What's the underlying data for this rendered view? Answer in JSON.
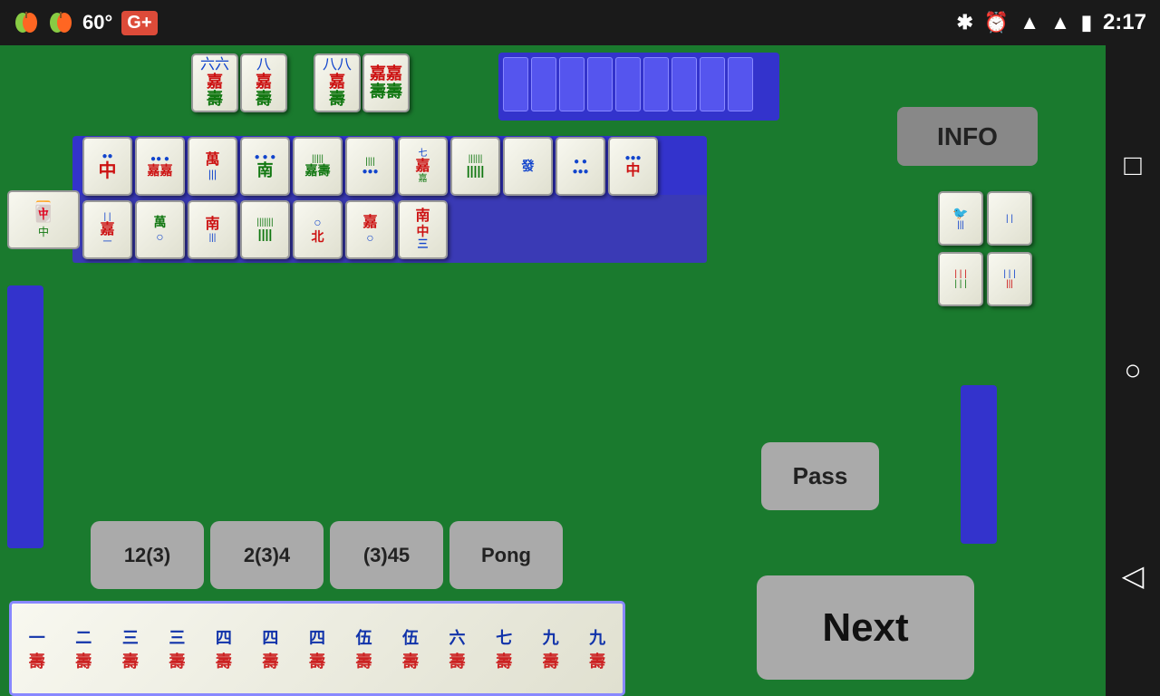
{
  "statusBar": {
    "temp": "60°",
    "gplus": "G+",
    "time": "2:17",
    "bluetooth": "⚡",
    "alarm": "⏰",
    "wifi": "▲",
    "signal": "▲",
    "battery": "🔋"
  },
  "infoButton": "INFO",
  "passButton": "Pass",
  "nextButton": "Next",
  "actionButtons": {
    "btn1": "12(3)",
    "btn2": "2(3)4",
    "btn3": "(3)45",
    "btn4": "Pong"
  },
  "rightSidebar": {
    "square": "□",
    "circle": "○",
    "triangle": "◁"
  },
  "bottomTiles": [
    {
      "top": "一",
      "bot": "壽"
    },
    {
      "top": "二",
      "bot": "壽"
    },
    {
      "top": "三",
      "bot": "壽"
    },
    {
      "top": "三",
      "bot": "壽"
    },
    {
      "top": "四",
      "bot": "壽"
    },
    {
      "top": "四",
      "bot": "壽"
    },
    {
      "top": "四",
      "bot": "壽"
    },
    {
      "top": "伍",
      "bot": "壽"
    },
    {
      "top": "伍",
      "bot": "壽"
    },
    {
      "top": "六",
      "bot": "壽"
    },
    {
      "top": "七",
      "bot": "壽"
    },
    {
      "top": "九",
      "bot": "壽"
    },
    {
      "top": "九",
      "bot": "壽"
    }
  ]
}
